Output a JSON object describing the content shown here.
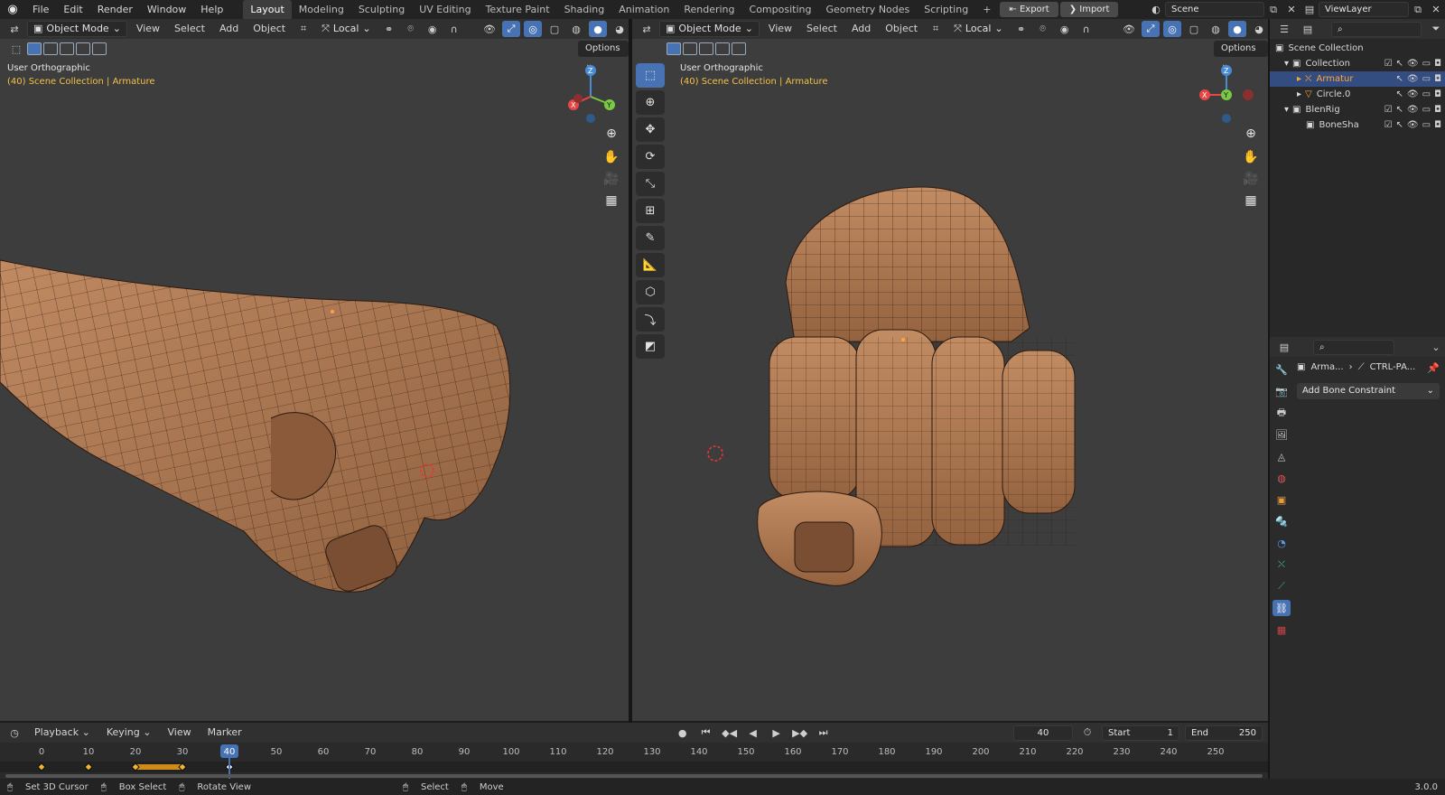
{
  "topbar": {
    "menus": [
      "File",
      "Edit",
      "Render",
      "Window",
      "Help"
    ],
    "workspaces": [
      "Layout",
      "Modeling",
      "Sculpting",
      "UV Editing",
      "Texture Paint",
      "Shading",
      "Animation",
      "Rendering",
      "Compositing",
      "Geometry Nodes",
      "Scripting"
    ],
    "active_workspace": "Layout",
    "add_workspace": "+",
    "export_label": "Export",
    "import_label": "Import",
    "scene_name": "Scene",
    "view_layer": "ViewLayer"
  },
  "left_viewport": {
    "mode": "Object Mode",
    "menus": [
      "View",
      "Select",
      "Add",
      "Object"
    ],
    "transform_orientation": "Local",
    "options": "Options",
    "view_name": "User Orthographic",
    "collection_label": "(40) Scene Collection | Armature"
  },
  "right_viewport": {
    "mode": "Object Mode",
    "menus": [
      "View",
      "Select",
      "Add",
      "Object"
    ],
    "transform_orientation": "Local",
    "options": "Options",
    "view_name": "User Orthographic",
    "collection_label": "(40) Scene Collection | Armature"
  },
  "gizmo": {
    "z": "Z",
    "y": "Y",
    "x": "X"
  },
  "outliner": {
    "root": "Scene Collection",
    "items": [
      {
        "label": "Collection",
        "depth": 1
      },
      {
        "label": "Armatur",
        "depth": 2,
        "selected": true
      },
      {
        "label": "Circle.0",
        "depth": 2
      },
      {
        "label": "BlenRig",
        "depth": 1
      },
      {
        "label": "BoneSha",
        "depth": 2
      }
    ]
  },
  "properties": {
    "breadcrumb_object": "Arma...",
    "breadcrumb_bone": "CTRL-PA...",
    "add_constraint": "Add Bone Constraint"
  },
  "timeline": {
    "menus": [
      "Playback",
      "Keying",
      "View",
      "Marker"
    ],
    "current_frame": "40",
    "start_label": "Start",
    "start_value": "1",
    "end_label": "End",
    "end_value": "250",
    "ticks": [
      "0",
      "10",
      "20",
      "30",
      "40",
      "50",
      "60",
      "70",
      "80",
      "90",
      "100",
      "110",
      "120",
      "130",
      "140",
      "150",
      "160",
      "170",
      "180",
      "190",
      "200",
      "210",
      "220",
      "230",
      "240",
      "250"
    ],
    "keyframes": [
      0,
      10,
      20,
      30,
      40
    ]
  },
  "statusbar": {
    "items": [
      "Set 3D Cursor",
      "Box Select",
      "Rotate View",
      "Select",
      "Move"
    ],
    "version": "3.0.0"
  },
  "colors": {
    "accent": "#4772b3",
    "selected_text": "#ffa43a",
    "label_yellow": "#f3c146",
    "skin": "#b07a55"
  }
}
